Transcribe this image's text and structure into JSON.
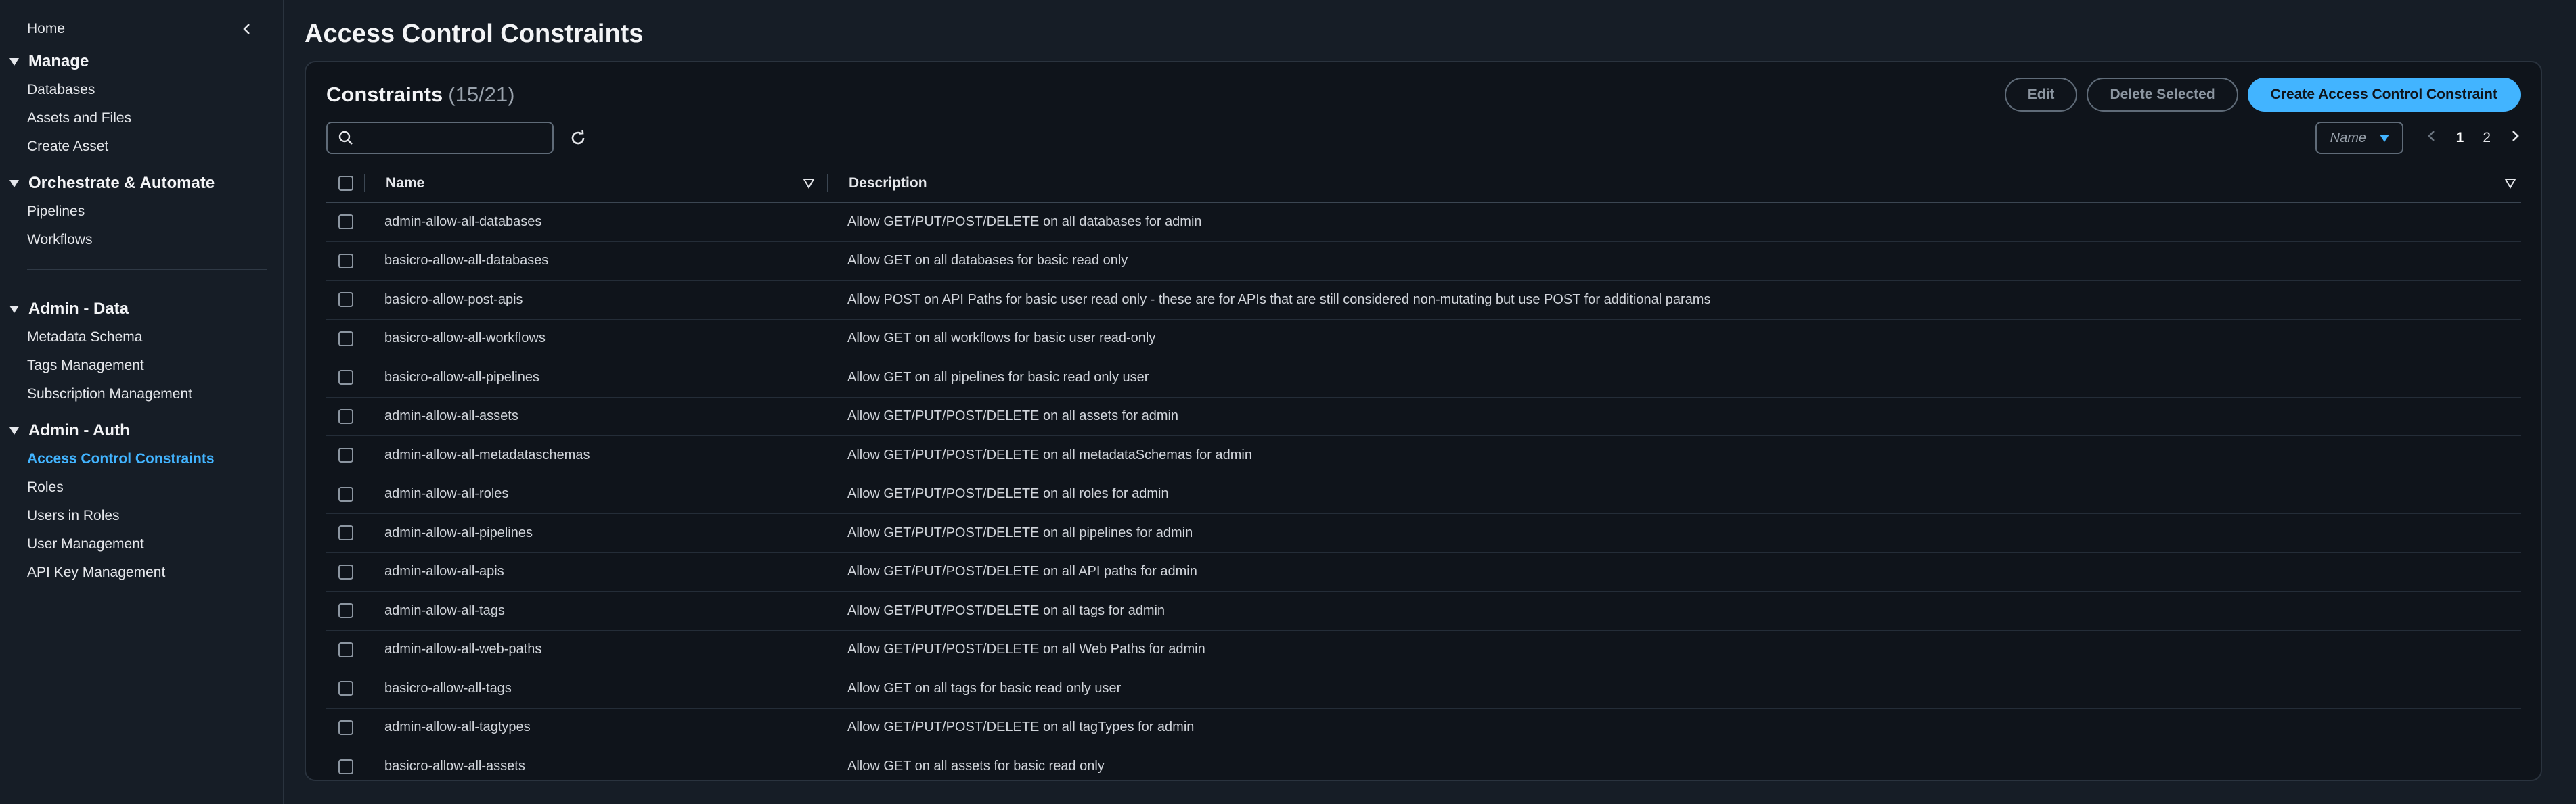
{
  "sidebar": {
    "home": "Home",
    "sections": [
      {
        "title": "Manage",
        "items": [
          "Databases",
          "Assets and Files",
          "Create Asset"
        ]
      },
      {
        "title": "Orchestrate & Automate",
        "items": [
          "Pipelines",
          "Workflows"
        ]
      },
      {
        "title": "Admin - Data",
        "items": [
          "Metadata Schema",
          "Tags Management",
          "Subscription Management"
        ]
      },
      {
        "title": "Admin - Auth",
        "items": [
          "Access Control Constraints",
          "Roles",
          "Users in Roles",
          "User Management",
          "API Key Management"
        ]
      }
    ],
    "active_item": "Access Control Constraints"
  },
  "page": {
    "title": "Access Control Constraints"
  },
  "panel": {
    "title": "Constraints",
    "count": "(15/21)",
    "edit_label": "Edit",
    "delete_label": "Delete Selected",
    "create_label": "Create Access Control Constraint"
  },
  "toolbar": {
    "search_value": "",
    "sort_label": "Name",
    "pages": [
      "1",
      "2"
    ],
    "current_page": "1"
  },
  "table": {
    "headers": {
      "name": "Name",
      "description": "Description"
    },
    "rows": [
      {
        "name": "admin-allow-all-databases",
        "description": "Allow GET/PUT/POST/DELETE on all databases for admin"
      },
      {
        "name": "basicro-allow-all-databases",
        "description": "Allow GET on all databases for basic read only"
      },
      {
        "name": "basicro-allow-post-apis",
        "description": "Allow POST on API Paths for basic user read only - these are for APIs that are still considered non-mutating but use POST for additional params"
      },
      {
        "name": "basicro-allow-all-workflows",
        "description": "Allow GET on all workflows for basic user read-only"
      },
      {
        "name": "basicro-allow-all-pipelines",
        "description": "Allow GET on all pipelines for basic read only user"
      },
      {
        "name": "admin-allow-all-assets",
        "description": "Allow GET/PUT/POST/DELETE on all assets for admin"
      },
      {
        "name": "admin-allow-all-metadataschemas",
        "description": "Allow GET/PUT/POST/DELETE on all metadataSchemas for admin"
      },
      {
        "name": "admin-allow-all-roles",
        "description": "Allow GET/PUT/POST/DELETE on all roles for admin"
      },
      {
        "name": "admin-allow-all-pipelines",
        "description": "Allow GET/PUT/POST/DELETE on all pipelines for admin"
      },
      {
        "name": "admin-allow-all-apis",
        "description": "Allow GET/PUT/POST/DELETE on all API paths for admin"
      },
      {
        "name": "admin-allow-all-tags",
        "description": "Allow GET/PUT/POST/DELETE on all tags for admin"
      },
      {
        "name": "admin-allow-all-web-paths",
        "description": "Allow GET/PUT/POST/DELETE on all Web Paths for admin"
      },
      {
        "name": "basicro-allow-all-tags",
        "description": "Allow GET on all tags for basic read only user"
      },
      {
        "name": "admin-allow-all-tagtypes",
        "description": "Allow GET/PUT/POST/DELETE on all tagTypes for admin"
      },
      {
        "name": "basicro-allow-all-assets",
        "description": "Allow GET on all assets for basic read only"
      }
    ]
  },
  "colors": {
    "accent": "#42b4ff",
    "background": "#161d26",
    "panel": "#0f141b"
  },
  "icons": {
    "collapse": "chevron-left-icon",
    "section_caret": "caret-down-icon",
    "search": "search-icon",
    "refresh": "refresh-icon",
    "sort_caret": "caret-down-icon",
    "filter": "filter-icon",
    "prev": "chevron-left-icon",
    "next": "chevron-right-icon"
  }
}
